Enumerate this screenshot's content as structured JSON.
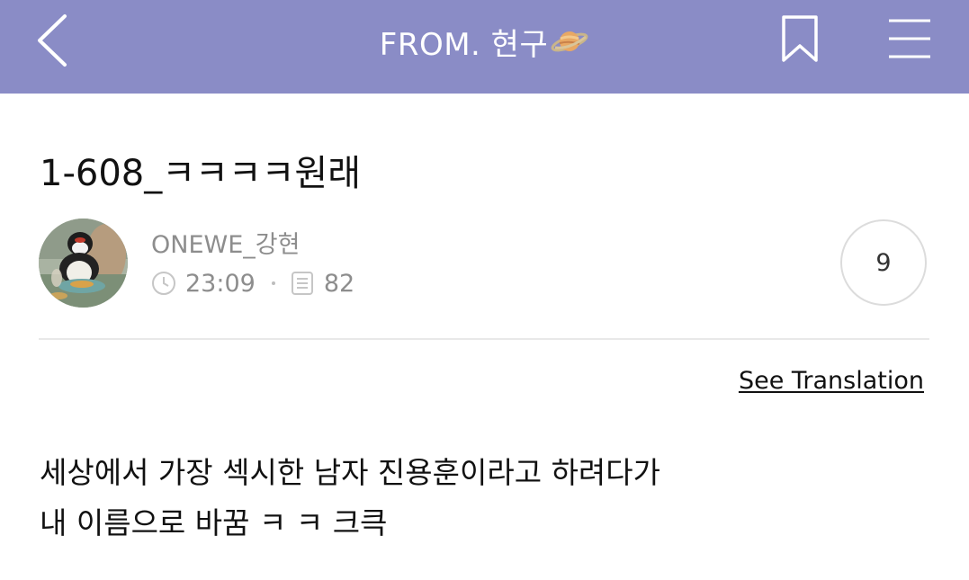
{
  "header": {
    "title": "FROM. 현구",
    "emoji": "planet-emoji",
    "back_icon": "chevron-left-icon",
    "bookmark_icon": "bookmark-icon",
    "menu_icon": "hamburger-menu-icon",
    "bg_color": "#8a8cc6"
  },
  "post": {
    "title": "1-608_ㅋㅋㅋㅋ원래",
    "author": "ONEWE_강현",
    "time": "23:09",
    "views": "82",
    "comment_count": "9",
    "see_translation": "See Translation",
    "body_lines": [
      "세상에서 가장 섹시한 남자 진용훈이라고 하려다가",
      "내 이름으로 바꿈 ㅋ ㅋ 크큭"
    ]
  }
}
